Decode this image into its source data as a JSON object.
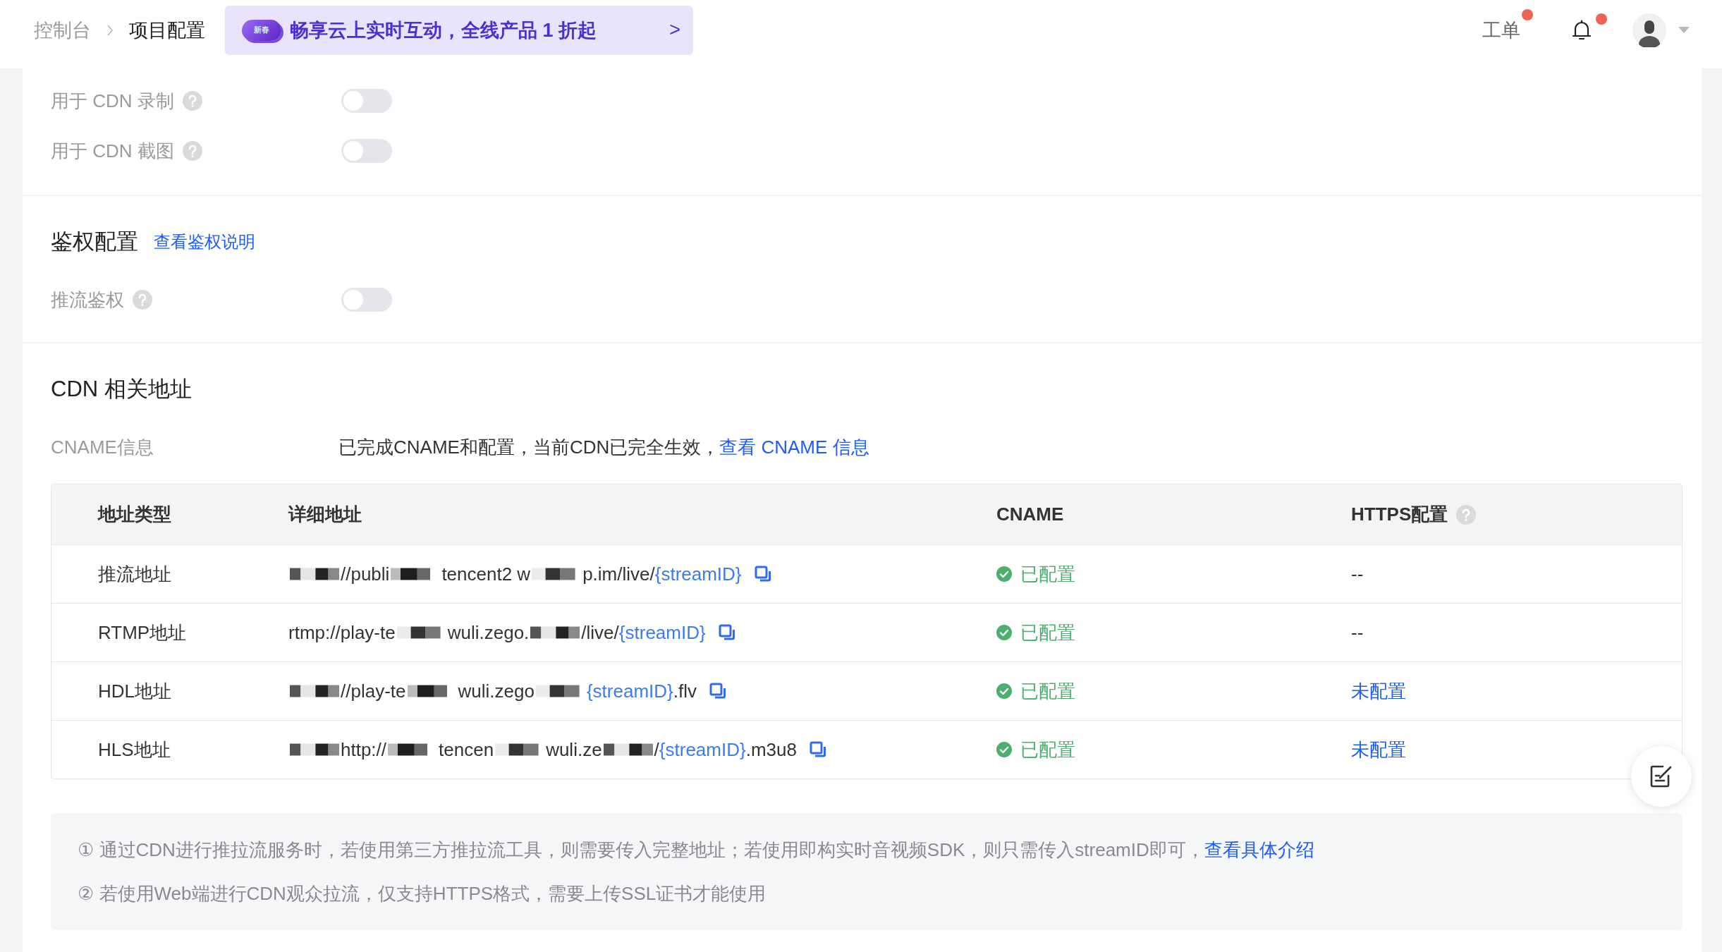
{
  "topbar": {
    "breadcrumb": [
      {
        "label": "控制台",
        "current": false
      },
      {
        "label": "项目配置",
        "current": true
      }
    ],
    "promo": {
      "badge": "新春",
      "text": "畅享云上实时互动，全线产品 1 折起",
      "arrow": ">"
    },
    "ticket": {
      "label": "工单",
      "unread": true
    },
    "notifications": {
      "unread": true
    }
  },
  "cdn_usage": {
    "rows": [
      {
        "label": "用于 CDN 录制",
        "help": true,
        "on": false
      },
      {
        "label": "用于 CDN 截图",
        "help": true,
        "on": false
      }
    ]
  },
  "auth": {
    "title": "鉴权配置",
    "link": "查看鉴权说明",
    "rows": [
      {
        "label": "推流鉴权",
        "help": true,
        "on": false
      }
    ]
  },
  "cdn_addresses": {
    "title": "CDN 相关地址",
    "cname_label": "CNAME信息",
    "cname_status": "已完成CNAME和配置，当前CDN已完全生效，",
    "cname_link": "查看 CNAME 信息",
    "table": {
      "columns": [
        {
          "label": "地址类型",
          "help": false
        },
        {
          "label": "详细地址",
          "help": false
        },
        {
          "label": "CNAME",
          "help": false
        },
        {
          "label": "HTTPS配置",
          "help": true
        }
      ],
      "rows": [
        {
          "type": "推流地址",
          "address": [
            {
              "kind": "redacted"
            },
            {
              "kind": "text",
              "text": "//publi"
            },
            {
              "kind": "redacted"
            },
            {
              "kind": "text",
              "text": "tencent2 w"
            },
            {
              "kind": "redacted"
            },
            {
              "kind": "text",
              "text": "p.im/live/"
            },
            {
              "kind": "var",
              "text": "{streamID}"
            }
          ],
          "cname": {
            "text": "已配置",
            "configured": true
          },
          "https": {
            "kind": "text",
            "text": "--"
          }
        },
        {
          "type": "RTMP地址",
          "address": [
            {
              "kind": "text",
              "text": "rtmp://play-te"
            },
            {
              "kind": "redacted"
            },
            {
              "kind": "text",
              "text": "wuli.zego."
            },
            {
              "kind": "redacted"
            },
            {
              "kind": "text",
              "text": "/live/"
            },
            {
              "kind": "var",
              "text": "{streamID}"
            }
          ],
          "cname": {
            "text": "已配置",
            "configured": true
          },
          "https": {
            "kind": "text",
            "text": "--"
          }
        },
        {
          "type": "HDL地址",
          "address": [
            {
              "kind": "redacted"
            },
            {
              "kind": "text",
              "text": "//play-te"
            },
            {
              "kind": "redacted"
            },
            {
              "kind": "text",
              "text": "wuli.zego"
            },
            {
              "kind": "redacted"
            },
            {
              "kind": "var",
              "text": "{streamID}"
            },
            {
              "kind": "text",
              "text": ".flv"
            }
          ],
          "cname": {
            "text": "已配置",
            "configured": true
          },
          "https": {
            "kind": "link",
            "text": "未配置"
          }
        },
        {
          "type": "HLS地址",
          "address": [
            {
              "kind": "redacted"
            },
            {
              "kind": "text",
              "text": "http://"
            },
            {
              "kind": "redacted"
            },
            {
              "kind": "text",
              "text": "tencen"
            },
            {
              "kind": "redacted"
            },
            {
              "kind": "text",
              "text": "wuli.ze"
            },
            {
              "kind": "redacted"
            },
            {
              "kind": "text",
              "text": "/"
            },
            {
              "kind": "var",
              "text": "{streamID}"
            },
            {
              "kind": "text",
              "text": ".m3u8"
            }
          ],
          "cname": {
            "text": "已配置",
            "configured": true
          },
          "https": {
            "kind": "link",
            "text": "未配置"
          }
        }
      ]
    }
  },
  "notes": [
    {
      "text": "① 通过CDN进行推拉流服务时，若使用第三方推拉流工具，则需要传入完整地址；若使用即构实时音视频SDK，则只需传入streamID即可，",
      "link": "查看具体介绍"
    },
    {
      "text": "② 若使用Web端进行CDN观众拉流，仅支持HTTPS格式，需要上传SSL证书才能使用"
    }
  ]
}
